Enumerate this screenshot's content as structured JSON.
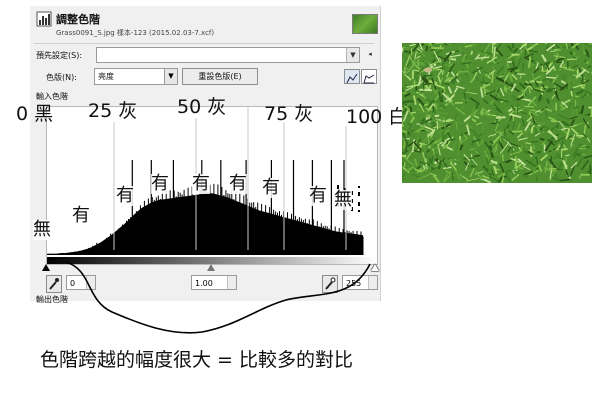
{
  "dialog": {
    "title": "調整色階",
    "subtitle": "Grass0091_S.jpg 樣本-123 (2015.02.03-7.xcf)",
    "preset_label": "預先設定(S):",
    "channel_label": "色版(N):",
    "channel_value": "亮度",
    "reset_channel_button": "重設色版(E)",
    "input_levels_label": "輸入色階",
    "output_levels_label": "輸出色階",
    "black_point": "0",
    "gamma": "1.00",
    "white_point": "255"
  },
  "histogram": {
    "values": [
      2,
      2,
      2,
      3,
      3,
      4,
      5,
      6,
      8,
      10,
      13,
      17,
      21,
      26,
      31,
      37,
      43,
      49,
      56,
      63,
      70,
      76,
      80,
      84,
      87,
      89,
      90,
      91,
      92,
      93,
      94,
      95,
      96,
      97,
      98,
      99,
      100,
      99,
      97,
      95,
      93,
      90,
      87,
      84,
      81,
      78,
      75,
      72,
      70,
      68,
      66,
      64,
      62,
      60,
      58,
      56,
      54,
      52,
      50,
      48,
      46,
      44,
      42,
      40,
      38,
      37,
      36,
      35,
      34,
      33,
      32
    ],
    "spikes": [
      0.27,
      0.33,
      0.4,
      0.49,
      0.55,
      0.63,
      0.71,
      0.78,
      0.84,
      0.9,
      0.94
    ]
  },
  "scale_labels": [
    "0 黑",
    "25 灰",
    "50 灰",
    "75 灰",
    "100 白"
  ],
  "marks": {
    "none": "無",
    "some": "有"
  },
  "caption": "色階跨越的幅度很大 = 比較多的對比",
  "colors": {
    "histogram_fill": "#000000",
    "annotation": "#111111",
    "guide_line": "#c8c8c8",
    "bracket": "#000000"
  }
}
